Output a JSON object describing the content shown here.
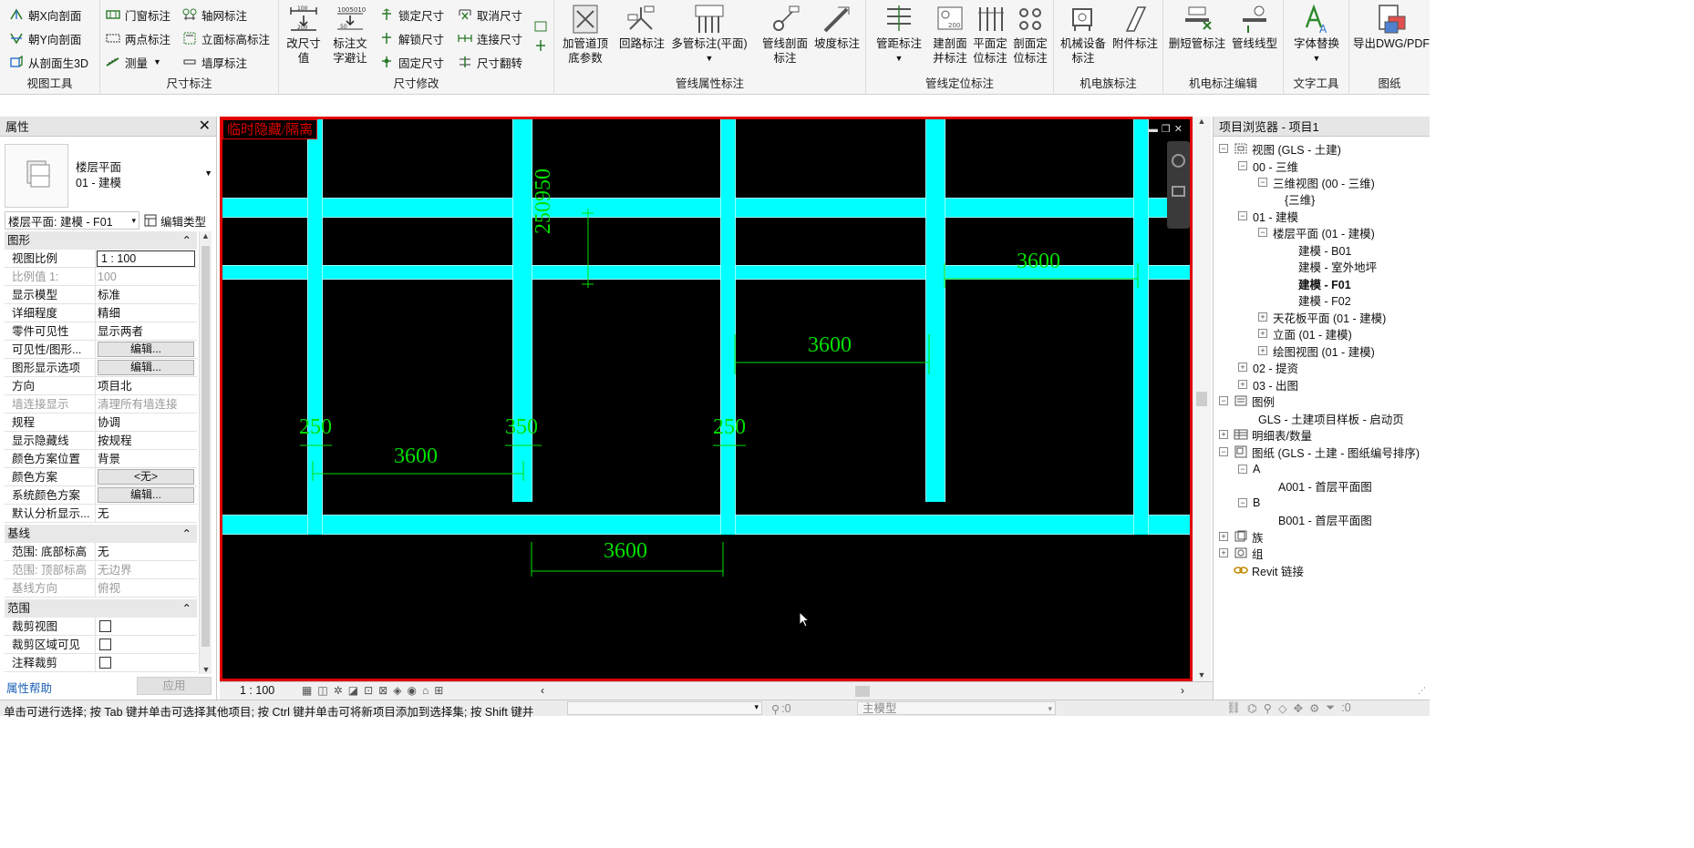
{
  "ribbon": {
    "panels": {
      "view_tools": {
        "title": "视图工具",
        "items": [
          "朝X向剖面",
          "朝Y向剖面",
          "从剖面生3D"
        ]
      },
      "dim_annot": {
        "title": "尺寸标注",
        "items": [
          "门窗标注",
          "两点标注",
          "测量",
          "轴网标注",
          "立面标高标注",
          "墙厚标注"
        ]
      },
      "dim_edit": {
        "title": "尺寸修改",
        "large": [
          "改尺寸值",
          "标注文字避让"
        ],
        "items": [
          "锁定尺寸",
          "解锁尺寸",
          "固定尺寸",
          "取消尺寸",
          "连接尺寸",
          "尺寸翻转"
        ]
      },
      "pipe_attr": {
        "title": "管线属性标注",
        "large": [
          "加管道顶底参数",
          "回路标注",
          "多管标注(平面)",
          "管线剖面标注",
          "坡度标注"
        ]
      },
      "pipe_pos": {
        "title": "管线定位标注",
        "large": [
          "管距标注",
          "建剖面并标注",
          "平面定位标注",
          "剖面定位标注"
        ]
      },
      "mep_family": {
        "title": "机电族标注",
        "large": [
          "机械设备标注",
          "附件标注"
        ]
      },
      "mep_edit": {
        "title": "机电标注编辑",
        "large": [
          "删短管标注",
          "管线线型"
        ]
      },
      "text_tools": {
        "title": "文字工具",
        "large": [
          "字体替换"
        ]
      },
      "drawing": {
        "title": "图纸",
        "large": [
          "导出DWG/PDF"
        ]
      }
    }
  },
  "properties": {
    "title": "属性",
    "type_name": "楼层平面",
    "type_sub": "01 - 建模",
    "selector": "楼层平面: 建模 - F01",
    "edit_type": "编辑类型",
    "sections": {
      "graphics": "图形",
      "underlay": "基线",
      "extents": "范围"
    },
    "rows": [
      {
        "label": "视图比例",
        "value": "1 : 100"
      },
      {
        "label": "比例值 1:",
        "value": "100"
      },
      {
        "label": "显示模型",
        "value": "标准"
      },
      {
        "label": "详细程度",
        "value": "精细"
      },
      {
        "label": "零件可见性",
        "value": "显示两者"
      },
      {
        "label": "可见性/图形...",
        "value": "编辑..."
      },
      {
        "label": "图形显示选项",
        "value": "编辑..."
      },
      {
        "label": "方向",
        "value": "项目北"
      },
      {
        "label": "墙连接显示",
        "value": "清理所有墙连接"
      },
      {
        "label": "规程",
        "value": "协调"
      },
      {
        "label": "显示隐藏线",
        "value": "按规程"
      },
      {
        "label": "颜色方案位置",
        "value": "背景"
      },
      {
        "label": "颜色方案",
        "value": "<无>"
      },
      {
        "label": "系统颜色方案",
        "value": "编辑..."
      },
      {
        "label": "默认分析显示...",
        "value": "无"
      }
    ],
    "underlay_rows": [
      {
        "label": "范围: 底部标高",
        "value": "无"
      },
      {
        "label": "范围: 顶部标高",
        "value": "无边界"
      },
      {
        "label": "基线方向",
        "value": "俯视"
      }
    ],
    "extents_rows": [
      {
        "label": "裁剪视图",
        "value": ""
      },
      {
        "label": "裁剪区域可见",
        "value": ""
      },
      {
        "label": "注释裁剪",
        "value": ""
      }
    ],
    "help": "属性帮助",
    "apply": "应用"
  },
  "canvas": {
    "banner": "临时隐藏/隔离",
    "dims": [
      "3600",
      "3600",
      "3600",
      "3600",
      "250",
      "350",
      "250",
      "250950"
    ]
  },
  "browser": {
    "title": "项目浏览器 - 项目1",
    "nodes": [
      "视图 (GLS - 土建)",
      "00 - 三维",
      "三维视图 (00 - 三维)",
      "{三维}",
      "01 - 建模",
      "楼层平面 (01 - 建模)",
      "建模 - B01",
      "建模 - 室外地坪",
      "建模 - F01",
      "建模 - F02",
      "天花板平面 (01 - 建模)",
      "立面 (01 - 建模)",
      "绘图视图 (01 - 建模)",
      "02 - 提资",
      "03 - 出图",
      "图例",
      "GLS - 土建项目样板 - 启动页",
      "明细表/数量",
      "图纸 (GLS - 土建 - 图纸编号排序)",
      "A",
      "A001 - 首层平面图",
      "B",
      "B001 - 首层平面图",
      "族",
      "组",
      "Revit 链接"
    ]
  },
  "viewbar": {
    "scale": "1 : 100"
  },
  "status": {
    "hint": "单击可进行选择; 按 Tab 键并单击可选择其他项目; 按 Ctrl 键并单击可将新项目添加到选择集; 按 Shift 键并",
    "coord": ":0",
    "model": "主模型",
    "filter": ":0"
  },
  "colors": {
    "accent": "#e00000",
    "column": "#00ffff",
    "dim": "#00e000",
    "canvas_bg": "#000000"
  }
}
